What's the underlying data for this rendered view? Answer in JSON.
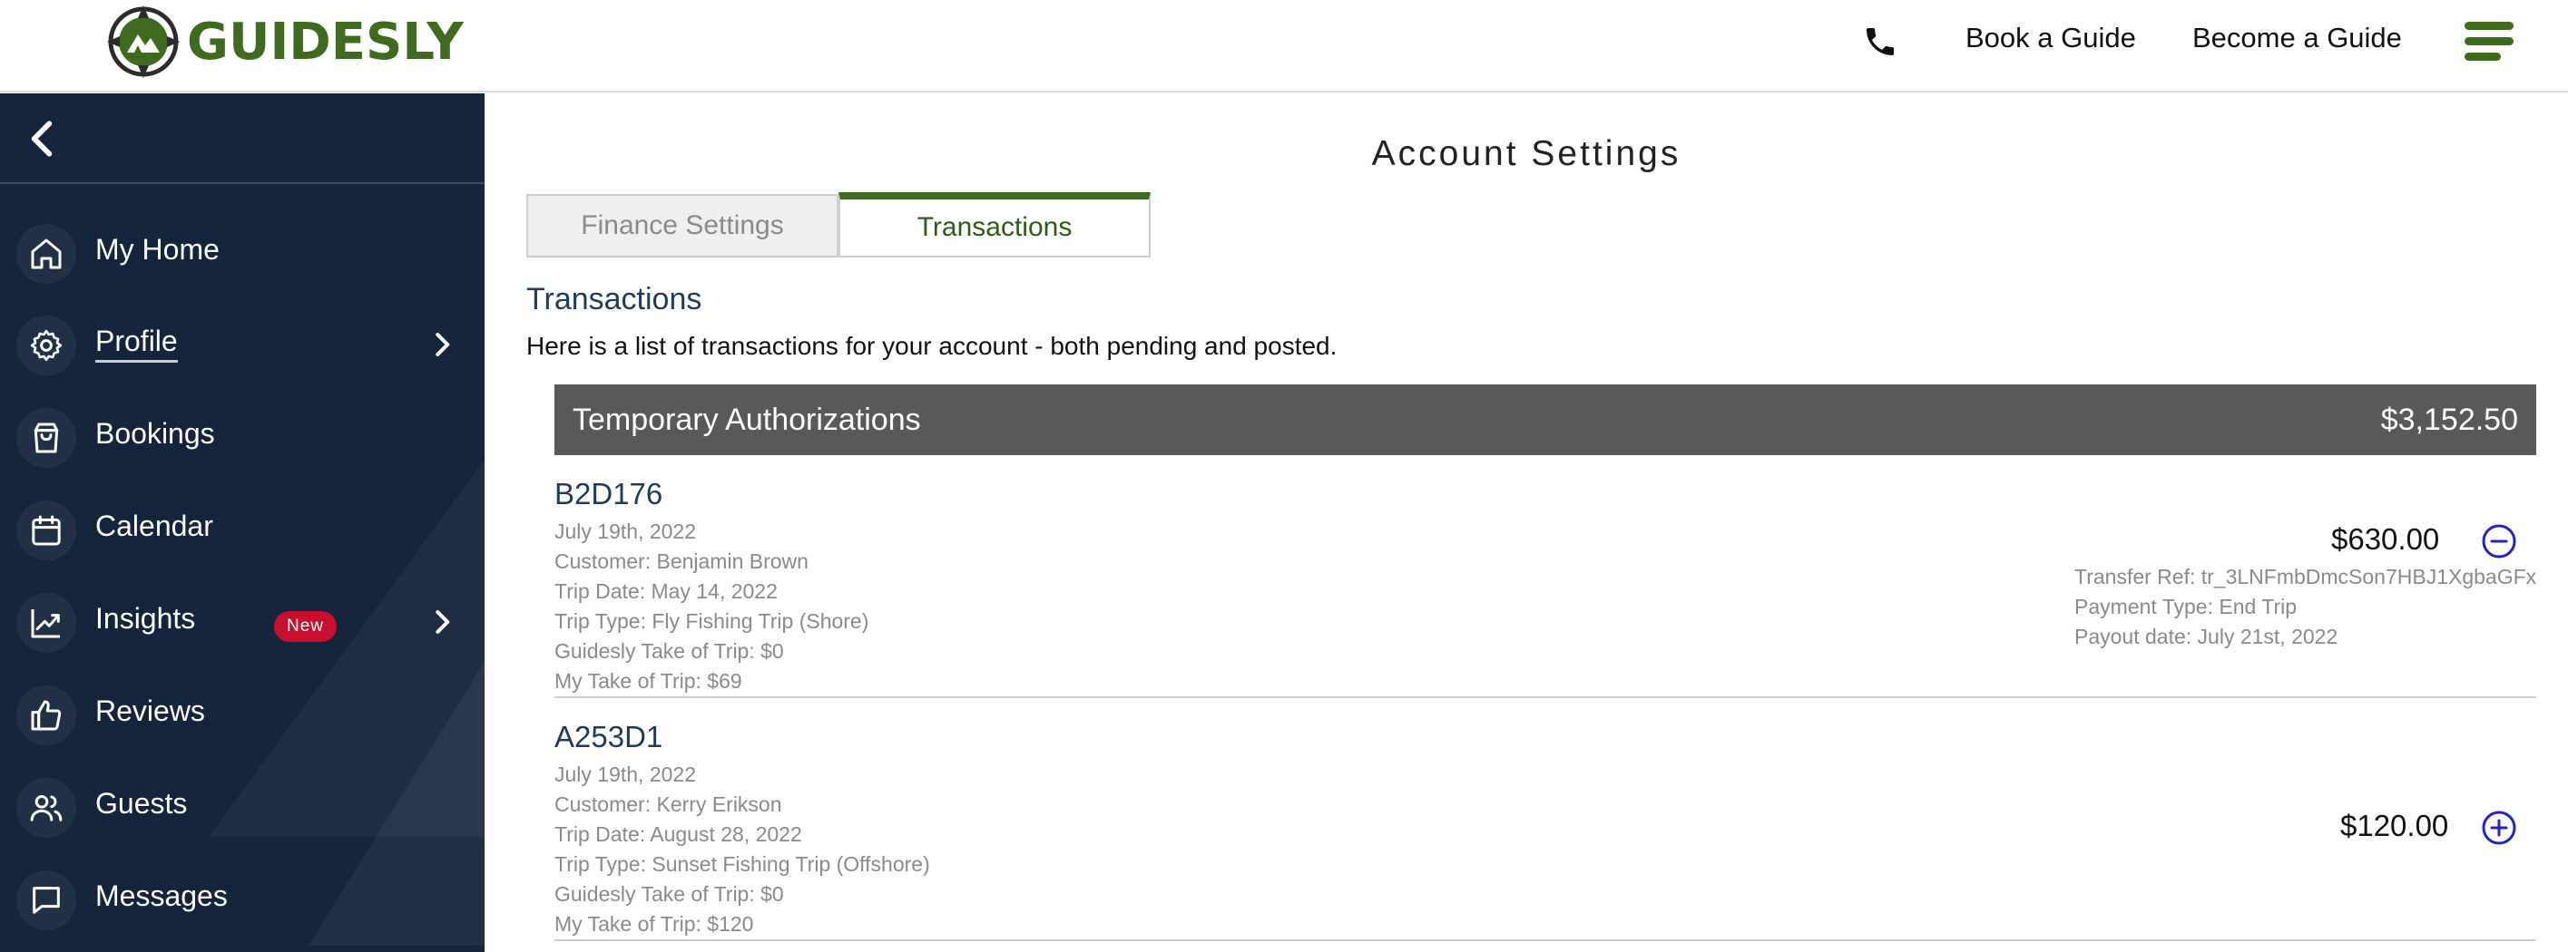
{
  "header": {
    "brand": "GUIDESLY",
    "links": [
      "Book a Guide",
      "Become a Guide"
    ],
    "icons": [
      "compass-logo-icon",
      "phone-icon",
      "hamburger-menu-icon"
    ],
    "brand_color": "#3f6b1f"
  },
  "sidebar": {
    "background": "#13243c",
    "items": [
      {
        "label": "My Home",
        "icon": "home-icon"
      },
      {
        "label": "Profile",
        "icon": "gear-icon",
        "has_submenu": true
      },
      {
        "label": "Bookings",
        "icon": "shopping-bag-icon"
      },
      {
        "label": "Calendar",
        "icon": "calendar-icon"
      },
      {
        "label": "Insights",
        "icon": "trend-chart-icon",
        "badge": "New",
        "has_submenu": true
      },
      {
        "label": "Reviews",
        "icon": "thumbs-up-icon"
      },
      {
        "label": "Guests",
        "icon": "users-icon"
      },
      {
        "label": "Messages",
        "icon": "message-icon"
      }
    ]
  },
  "main": {
    "title": "Account Settings",
    "tabs": [
      {
        "label": "Finance Settings",
        "active": false
      },
      {
        "label": "Transactions",
        "active": true
      }
    ],
    "section_title": "Transactions",
    "section_desc": "Here is a list of transactions for your account - both pending and posted.",
    "group": {
      "title": "Temporary Authorizations",
      "total": "$3,152.50"
    },
    "transactions": [
      {
        "code": "B2D176",
        "date": "July 19th, 2022",
        "customer": "Customer: Benjamin Brown",
        "trip_date": "Trip Date: May 14, 2022",
        "trip_type": "Trip Type: Fly Fishing Trip (Shore)",
        "guidesly_take": "Guidesly Take of Trip: $0",
        "my_take": "My Take of Trip: $69",
        "amount": "$630.00",
        "expanded": true,
        "transfer_ref": "Transfer Ref: tr_3LNFmbDmcSon7HBJ1XgbaGFx",
        "payment_type": "Payment Type: End Trip",
        "payout_date": "Payout date: July 21st, 2022"
      },
      {
        "code": "A253D1",
        "date": "July 19th, 2022",
        "customer": "Customer: Kerry Erikson",
        "trip_date": "Trip Date: August 28, 2022",
        "trip_type": "Trip Type: Sunset Fishing Trip (Offshore)",
        "guidesly_take": "Guidesly Take of Trip: $0",
        "my_take": "My Take of Trip: $120",
        "amount": "$120.00",
        "expanded": false
      }
    ]
  }
}
